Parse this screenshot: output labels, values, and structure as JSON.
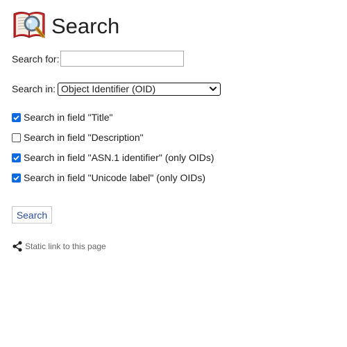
{
  "header": {
    "icon": "book-magnifier-icon",
    "title": "Search"
  },
  "form": {
    "search_for_label": "Search for:",
    "search_for_value": "",
    "search_for_placeholder": "",
    "search_in_label": "Search in:",
    "search_in_selected": "Object Identifier (OID)"
  },
  "checkboxes": [
    {
      "label": "Search in field \"Title\"",
      "checked": true
    },
    {
      "label": "Search in field \"Description\"",
      "checked": false
    },
    {
      "label": "Search in field \"ASN.1 identifier\" (only OIDs)",
      "checked": true
    },
    {
      "label": "Search in field \"Unicode label\" (only OIDs)",
      "checked": true
    }
  ],
  "actions": {
    "search_button_label": "Search"
  },
  "footer": {
    "static_link_icon": "share-icon",
    "static_link_label": "Static link to this page"
  },
  "colors": {
    "checkbox_accent": "#0b69e1",
    "button_text": "#2d4f9e",
    "link_text": "#666666"
  }
}
